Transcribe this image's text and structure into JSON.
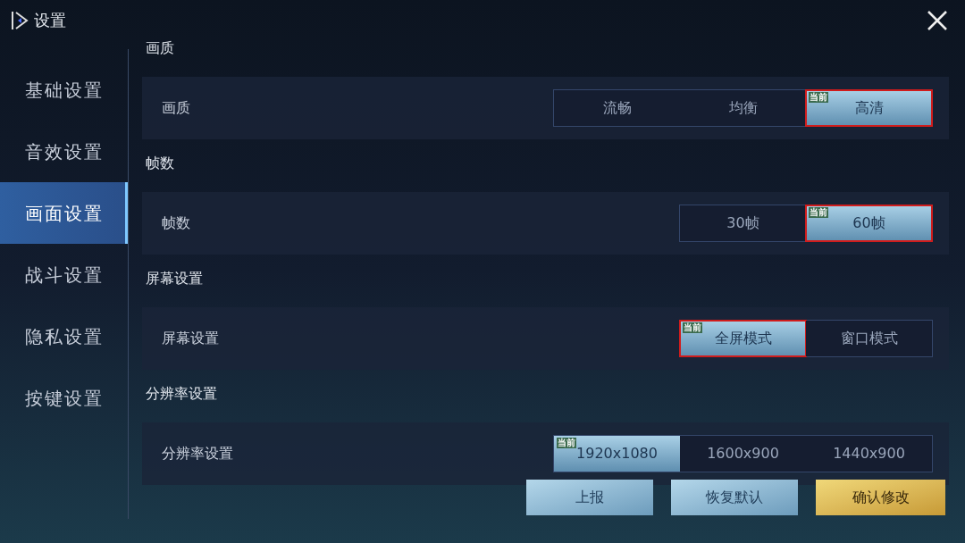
{
  "window": {
    "title": "设置"
  },
  "sidebar": {
    "items": [
      {
        "label": "基础设置",
        "selected": false
      },
      {
        "label": "音效设置",
        "selected": false
      },
      {
        "label": "画面设置",
        "selected": true
      },
      {
        "label": "战斗设置",
        "selected": false
      },
      {
        "label": "隐私设置",
        "selected": false
      },
      {
        "label": "按键设置",
        "selected": false
      }
    ]
  },
  "sections": [
    {
      "title": "画质",
      "row_label": "画质",
      "options": [
        {
          "label": "流畅",
          "selected": false,
          "highlighted": false
        },
        {
          "label": "均衡",
          "selected": false,
          "highlighted": false
        },
        {
          "label": "高清",
          "selected": true,
          "highlighted": true,
          "badge": "当前"
        }
      ]
    },
    {
      "title": "帧数",
      "row_label": "帧数",
      "options": [
        {
          "label": "30帧",
          "selected": false,
          "highlighted": false
        },
        {
          "label": "60帧",
          "selected": true,
          "highlighted": true,
          "badge": "当前"
        }
      ]
    },
    {
      "title": "屏幕设置",
      "row_label": "屏幕设置",
      "options": [
        {
          "label": "全屏模式",
          "selected": true,
          "highlighted": true,
          "badge": "当前"
        },
        {
          "label": "窗口模式",
          "selected": false,
          "highlighted": false
        }
      ]
    },
    {
      "title": "分辨率设置",
      "row_label": "分辨率设置",
      "options": [
        {
          "label": "1920x1080",
          "selected": true,
          "highlighted": false,
          "badge": "当前"
        },
        {
          "label": "1600x900",
          "selected": false,
          "highlighted": false
        },
        {
          "label": "1440x900",
          "selected": false,
          "highlighted": false
        }
      ]
    }
  ],
  "buttons": [
    {
      "label": "上报",
      "kind": "blue"
    },
    {
      "label": "恢复默认",
      "kind": "blue"
    },
    {
      "label": "确认修改",
      "kind": "gold"
    }
  ]
}
